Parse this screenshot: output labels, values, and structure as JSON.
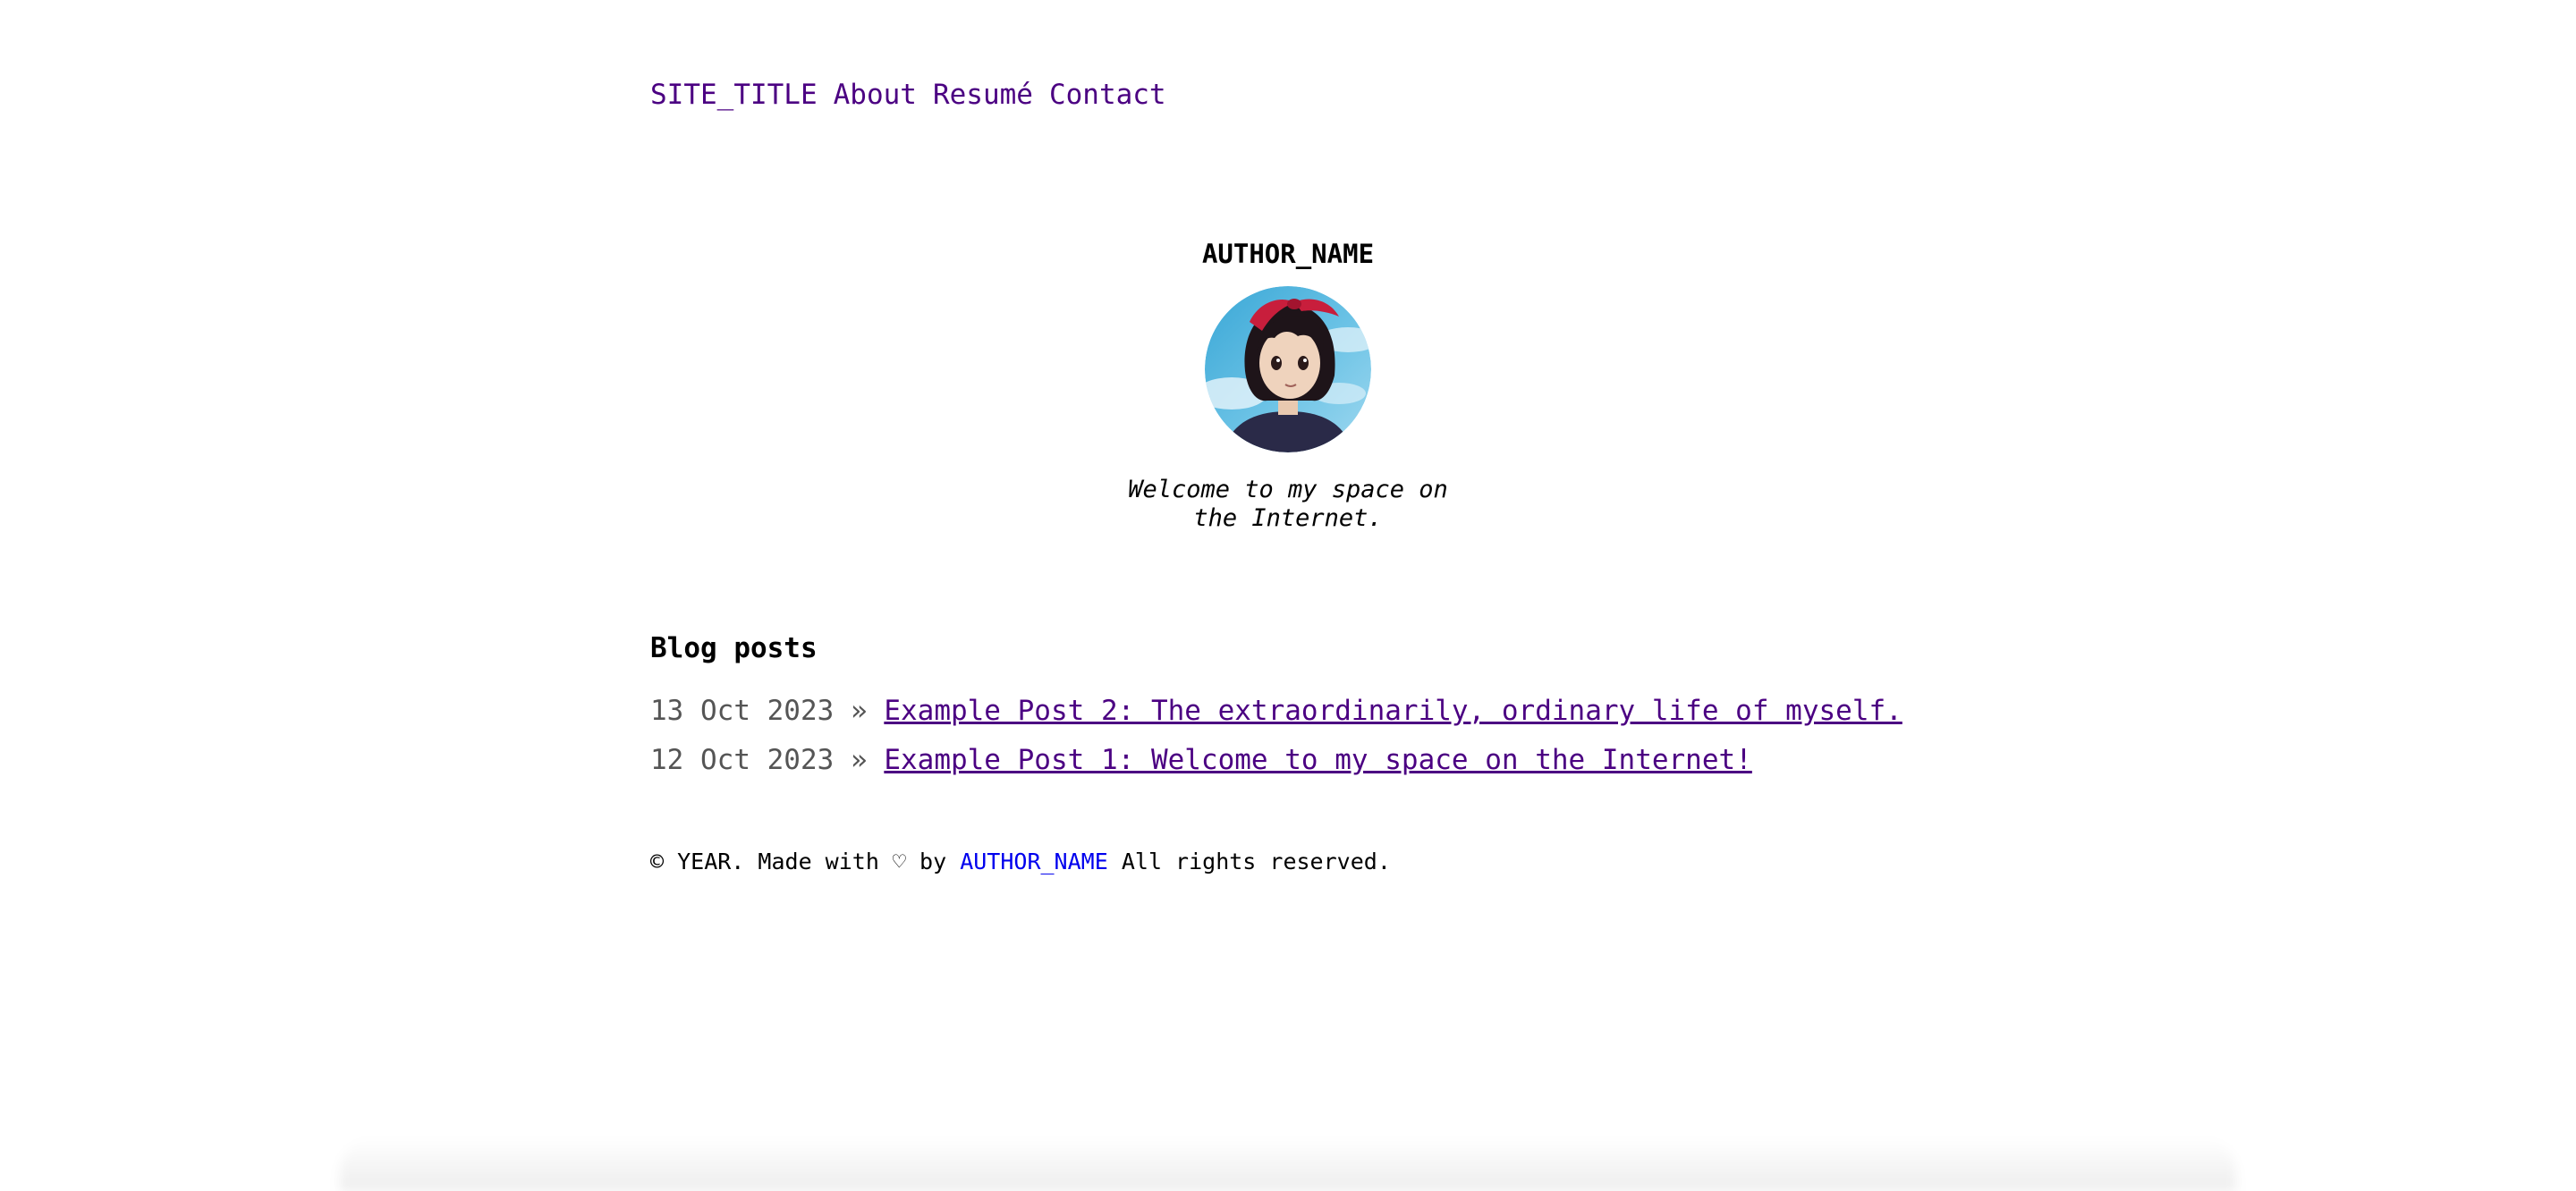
{
  "nav": {
    "site_title": "SITE_TITLE",
    "items": [
      {
        "label": "About"
      },
      {
        "label": "Resumé"
      },
      {
        "label": "Contact"
      }
    ]
  },
  "profile": {
    "author_name": "AUTHOR_NAME",
    "avatar_icon": "anime-girl-avatar-icon",
    "tagline": "Welcome to my space on the Internet."
  },
  "blog": {
    "heading": "Blog posts",
    "separator": "»",
    "posts": [
      {
        "date": "13 Oct 2023",
        "title": "Example Post 2: The extraordinarily, ordinary life of myself."
      },
      {
        "date": "12 Oct 2023",
        "title": "Example Post 1: Welcome to my space on the Internet!"
      }
    ]
  },
  "footer": {
    "prefix": "© YEAR. Made with ♡ by",
    "author_link": "AUTHOR_NAME",
    "suffix": "All rights reserved."
  },
  "colors": {
    "link_visited": "#4b0082",
    "link": "#0000ee",
    "date": "#555555",
    "background": "#ffffff"
  }
}
